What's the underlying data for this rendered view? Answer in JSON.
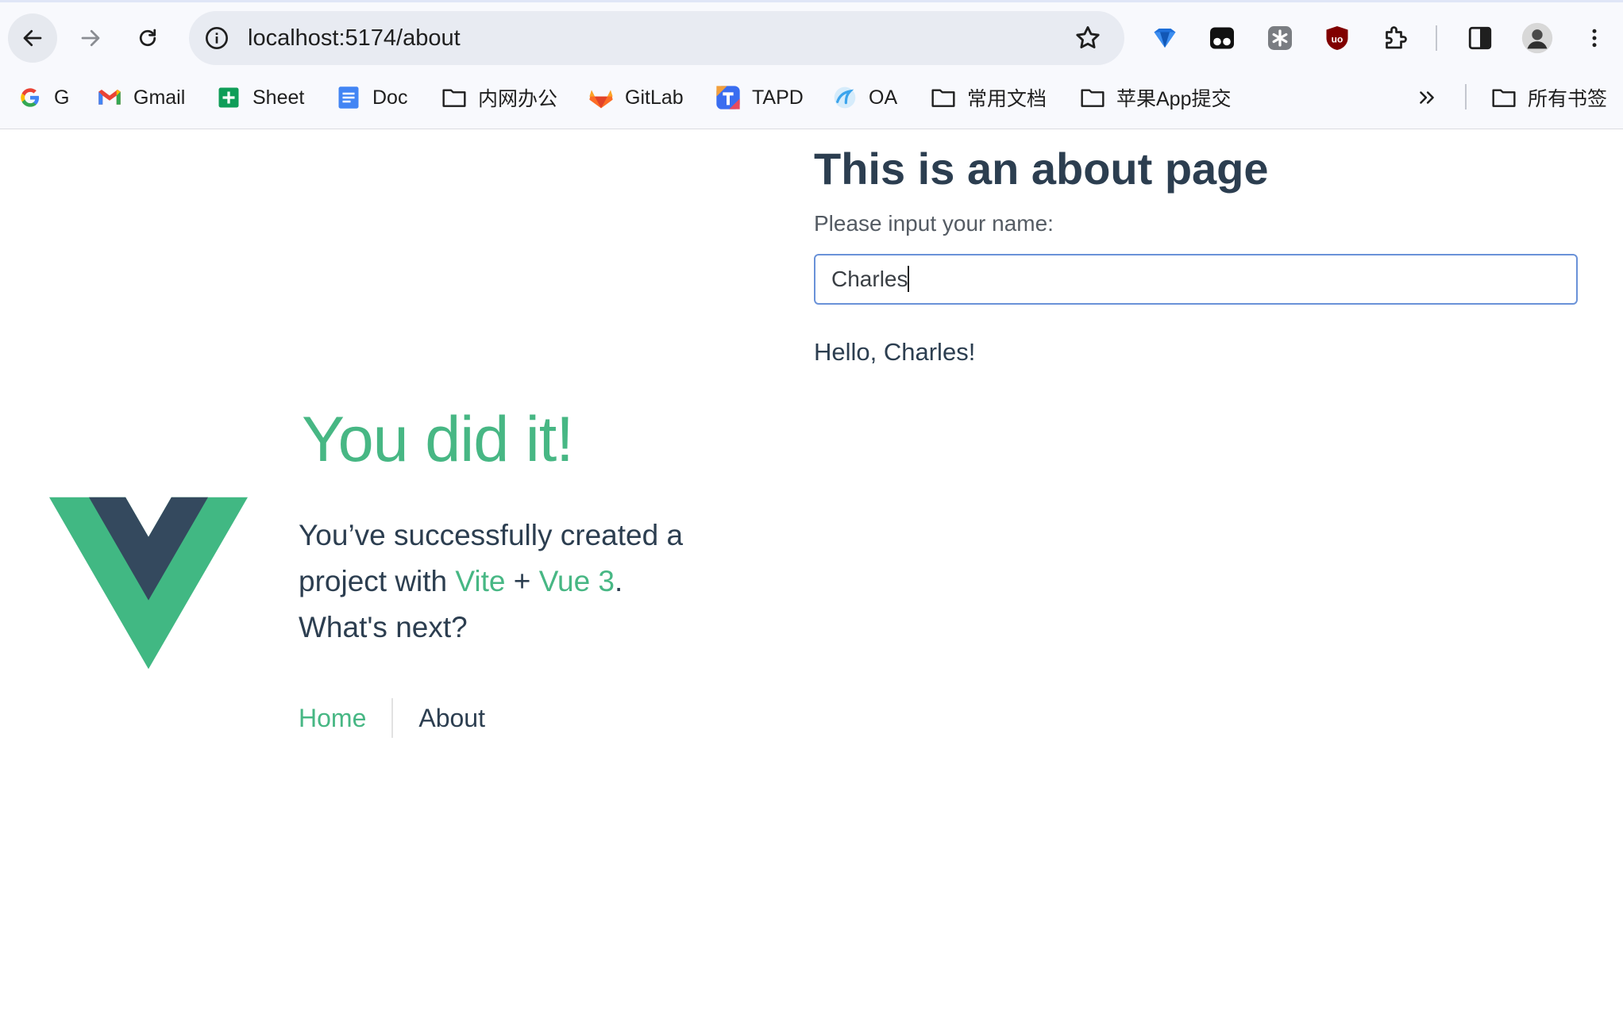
{
  "browser": {
    "url": "localhost:5174/about",
    "bookmarks": [
      {
        "label": "G",
        "icon": "google-icon"
      },
      {
        "label": "Gmail",
        "icon": "gmail-icon"
      },
      {
        "label": "Sheet",
        "icon": "sheets-icon"
      },
      {
        "label": "Doc",
        "icon": "docs-icon"
      },
      {
        "label": "内网办公",
        "icon": "folder-icon"
      },
      {
        "label": "GitLab",
        "icon": "gitlab-icon"
      },
      {
        "label": "TAPD",
        "icon": "tapd-icon"
      },
      {
        "label": "OA",
        "icon": "oa-icon"
      },
      {
        "label": "常用文档",
        "icon": "folder-icon"
      },
      {
        "label": "苹果App提交",
        "icon": "folder-icon"
      }
    ],
    "all_bookmarks_label": "所有书签",
    "colors": {
      "accent": "#47b784",
      "text": "#2c3e50",
      "input_border": "#6a92d8"
    }
  },
  "about": {
    "title": "This is an about page",
    "input_label": "Please input your name:",
    "input_value": "Charles",
    "greeting": "Hello, Charles!"
  },
  "hero": {
    "title": "You did it!",
    "text_before": "You’ve successfully created a project with",
    "link_vite": "Vite",
    "plus": "+",
    "link_vue": "Vue 3",
    "period": ".",
    "text_after": "What's next?"
  },
  "nav": {
    "home": "Home",
    "about": "About"
  }
}
